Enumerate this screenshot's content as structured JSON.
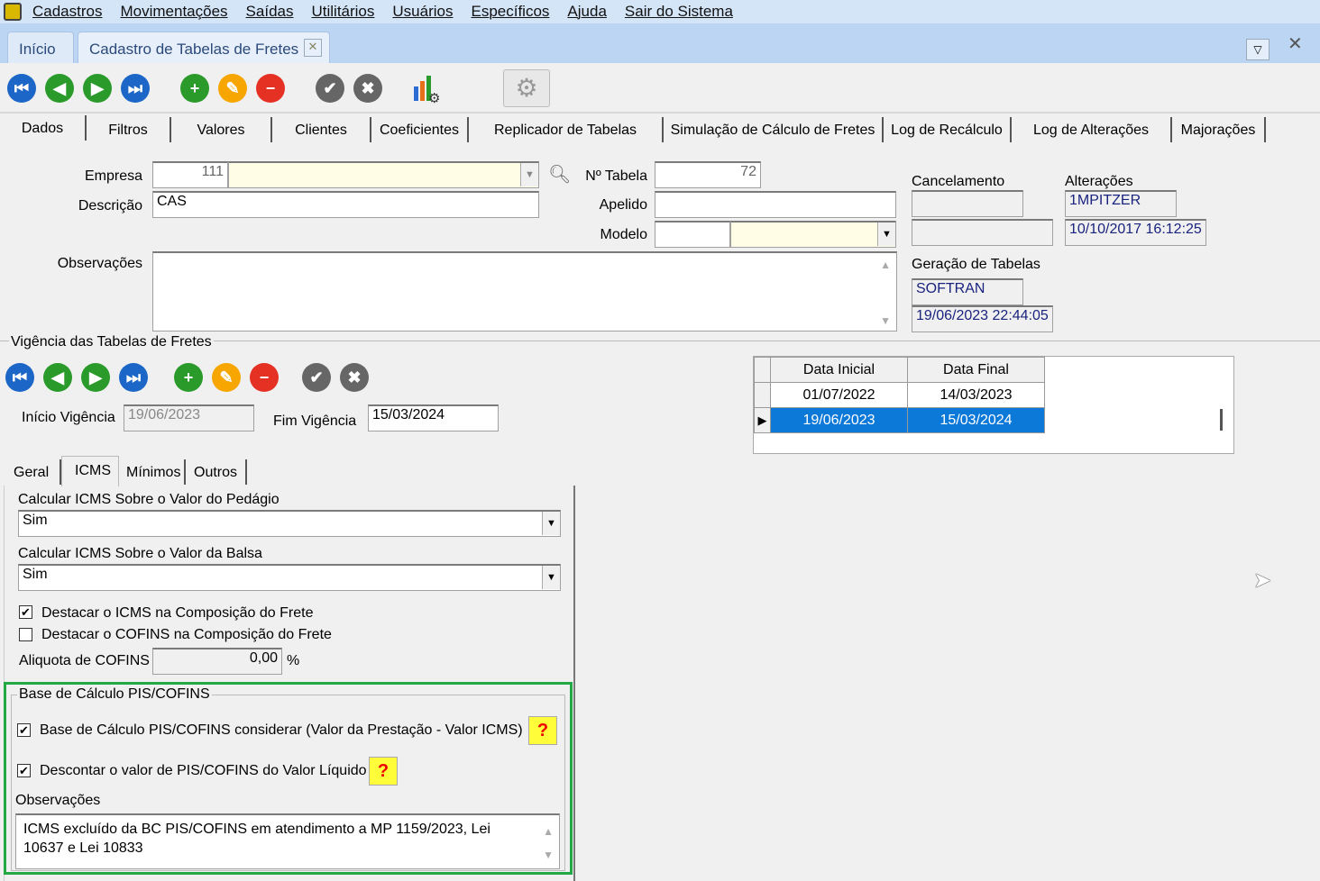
{
  "menu": [
    "Cadastros",
    "Movimentações",
    "Saídas",
    "Utilitários",
    "Usuários",
    "Específicos",
    "Ajuda",
    "Sair do Sistema"
  ],
  "doc_tabs": {
    "home": "Início",
    "active": "Cadastro de Tabelas de Fretes"
  },
  "form_tabs": [
    "Dados",
    "Filtros",
    "Valores",
    "Clientes",
    "Coeficientes",
    "Replicador de Tabelas",
    "Simulação de Cálculo de Fretes",
    "Log de Recálculo",
    "Log de Alterações",
    "Majorações"
  ],
  "fields": {
    "empresa_label": "Empresa",
    "empresa_code": "111",
    "descricao_label": "Descrição",
    "descricao": "CAS",
    "ntabela_label": "Nº Tabela",
    "ntabela": "72",
    "apelido_label": "Apelido",
    "modelo_label": "Modelo",
    "obs_label": "Observações",
    "cancelamento_label": "Cancelamento",
    "alteracoes_label": "Alterações",
    "alteracoes_user": "1MPITZER",
    "alteracoes_date": "10/10/2017 16:12:25",
    "geracao_label": "Geração de Tabelas",
    "geracao_user": "SOFTRAN",
    "geracao_date": "19/06/2023 22:44:05"
  },
  "vigencia": {
    "title": "Vigência das Tabelas de Fretes",
    "inicio_label": "Início Vigência",
    "inicio": "19/06/2023",
    "fim_label": "Fim Vigência",
    "fim": "15/03/2024",
    "columns": [
      "Data Inicial",
      "Data Final"
    ],
    "rows": [
      [
        "01/07/2022",
        "14/03/2023"
      ],
      [
        "19/06/2023",
        "15/03/2024"
      ]
    ]
  },
  "sub_tabs": [
    "Geral",
    "ICMS",
    "Mínimos",
    "Outros"
  ],
  "icms": {
    "pedagio_label": "Calcular ICMS Sobre o Valor do Pedágio",
    "pedagio": "Sim",
    "balsa_label": "Calcular ICMS Sobre o Valor da Balsa",
    "balsa": "Sim",
    "destacar_icms": "Destacar o ICMS na Composição do Frete",
    "destacar_cofins": "Destacar o COFINS na Composição do Frete",
    "aliquota_label": "Aliquota de COFINS",
    "aliquota": "0,00",
    "pct": "%"
  },
  "pis": {
    "title": "Base de Cálculo PIS/COFINS",
    "opt1": "Base de Cálculo PIS/COFINS considerar (Valor da Prestação - Valor ICMS)",
    "opt2": "Descontar o valor de PIS/COFINS do Valor Líquido",
    "help": "?",
    "obs_label": "Observações",
    "obs": "ICMS excluído da BC PIS/COFINS em atendimento a MP 1159/2023, Lei 10637 e Lei 10833"
  }
}
